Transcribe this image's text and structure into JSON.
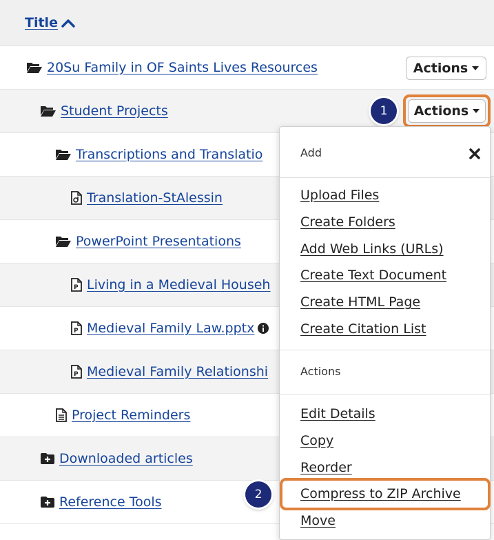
{
  "header": {
    "title": "Title"
  },
  "rows": [
    {
      "label": "20Su Family in OF Saints Lives Resources",
      "icon": "folder-open-icon",
      "action": "Actions"
    },
    {
      "label": "Student Projects",
      "icon": "folder-open-icon",
      "action": "Actions"
    },
    {
      "label": "Transcriptions and Translatio",
      "icon": "folder-open-icon"
    },
    {
      "label": "Translation-StAlessin",
      "icon": "audio-file-icon"
    },
    {
      "label": "PowerPoint Presentations",
      "icon": "folder-open-icon"
    },
    {
      "label": "Living in a Medieval Househ",
      "icon": "powerpoint-file-icon"
    },
    {
      "label": "Medieval Family Law.pptx",
      "icon": "powerpoint-file-icon"
    },
    {
      "label": "Medieval Family Relationshi",
      "icon": "powerpoint-file-icon"
    },
    {
      "label": "Project Reminders",
      "icon": "text-file-icon"
    },
    {
      "label": "Downloaded articles",
      "icon": "folder-plus-icon"
    },
    {
      "label": "Reference Tools",
      "icon": "folder-plus-icon"
    }
  ],
  "dropdown": {
    "add_heading": "Add",
    "add_items": [
      "Upload Files",
      "Create Folders",
      "Add Web Links (URLs)",
      "Create Text Document",
      "Create HTML Page",
      "Create Citation List"
    ],
    "actions_heading": "Actions",
    "action_items": [
      "Edit Details",
      "Copy",
      "Reorder",
      "Compress to ZIP Archive",
      "Move"
    ]
  },
  "callouts": {
    "step1": "1",
    "step2": "2"
  },
  "colors": {
    "link": "#15449b",
    "highlight": "#e0823c",
    "badge": "#1c2a78"
  }
}
